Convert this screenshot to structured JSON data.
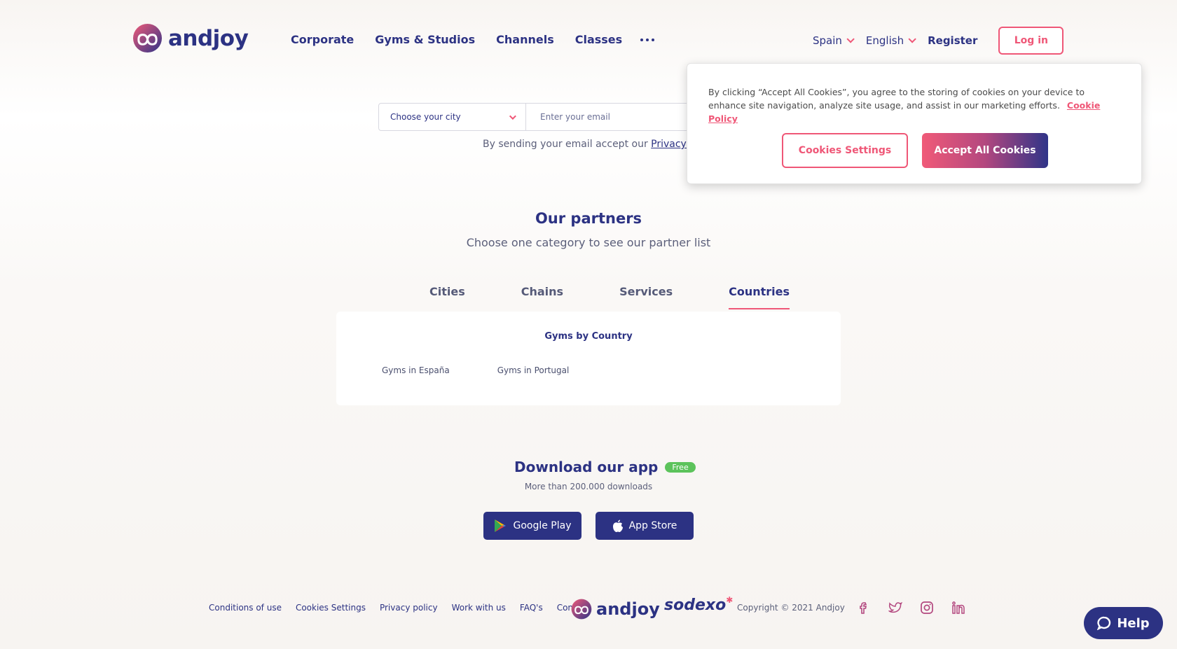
{
  "header": {
    "brand": "andjoy",
    "nav": [
      "Corporate",
      "Gyms & Studios",
      "Channels",
      "Classes"
    ],
    "country": "Spain",
    "language": "English",
    "register_label": "Register",
    "login_label": "Log in"
  },
  "signup": {
    "city_placeholder": "Choose your city",
    "email_placeholder": "Enter your email",
    "privacy_prefix": "By sending your email accept our",
    "privacy_link": "Privacy polic"
  },
  "cookie_banner": {
    "text": "By clicking “Accept All Cookies”, you agree to the storing of cookies on your device to enhance site navigation, analyze site usage, and assist in our marketing efforts.",
    "policy_link": "Cookie Policy",
    "settings_label": "Cookies Settings",
    "accept_label": "Accept All Cookies"
  },
  "partners": {
    "title": "Our partners",
    "subtitle": "Choose one category to see our partner list",
    "tabs": [
      "Cities",
      "Chains",
      "Services",
      "Countries"
    ],
    "active_tab": "Countries",
    "panel_title": "Gyms by Country",
    "links": [
      "Gyms in España",
      "Gyms in Portugal"
    ]
  },
  "download": {
    "title": "Download our app",
    "badge": "Free",
    "subtitle": "More than 200.000 downloads",
    "google_play_label": "Google Play",
    "app_store_label": "App Store"
  },
  "footer": {
    "links": [
      "Conditions of use",
      "Cookies Settings",
      "Privacy policy",
      "Work with us",
      "FAQ's",
      "Contact"
    ],
    "brand": "andjoy",
    "partner_brand": "sodexo",
    "copyright": "Copyright © 2021 Andjoy",
    "social_icons": [
      "facebook-icon",
      "twitter-icon",
      "instagram-icon",
      "linkedin-icon"
    ]
  },
  "help_label": "Help",
  "colors": {
    "primary": "#2c3283",
    "accent": "#ef5777",
    "badge_green": "#5cc35b"
  }
}
